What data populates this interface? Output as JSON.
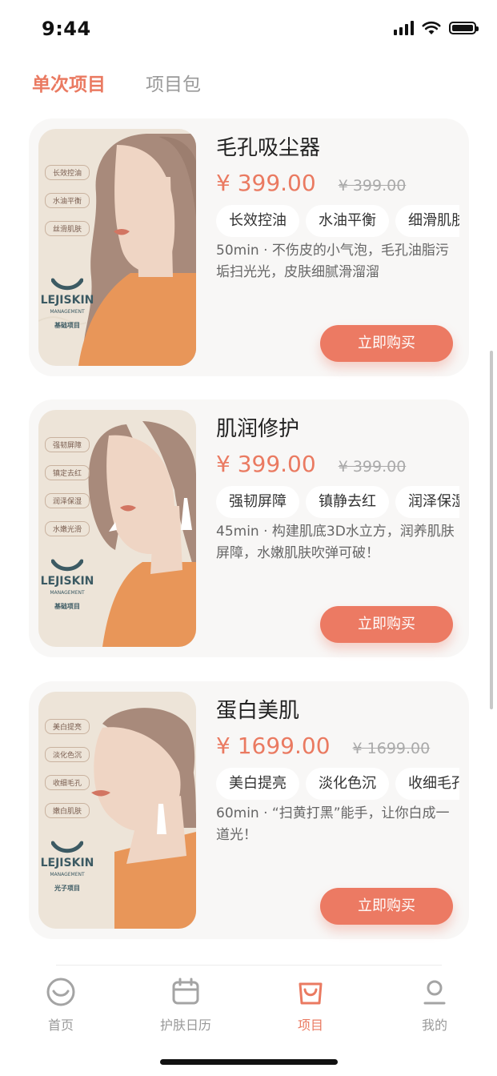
{
  "status": {
    "time": "9:44"
  },
  "tabs": [
    {
      "label": "单次项目",
      "active": true
    },
    {
      "label": "项目包",
      "active": false
    }
  ],
  "products": [
    {
      "title": "毛孔吸尘器",
      "price": "¥ 399.00",
      "original_price": "¥ 399.00",
      "tags": [
        "长效控油",
        "水油平衡",
        "细滑肌肤"
      ],
      "description": "50min · 不伤皮的小气泡，毛孔油脂污垢扫光光，皮肤细腻滑溜溜",
      "button": "立即购买",
      "image": {
        "side_labels": [
          "长效控油",
          "水油平衡",
          "丝滑肌肤"
        ],
        "brand": "LEJISKIN",
        "brand_sub": "MANAGEMENT",
        "category": "基础项目"
      }
    },
    {
      "title": "肌润修护",
      "price": "¥ 399.00",
      "original_price": "¥ 399.00",
      "tags": [
        "强韧屏障",
        "镇静去红",
        "润泽保湿"
      ],
      "description": "45min · 构建肌底3D水立方，润养肌肤屏障，水嫩肌肤吹弹可破！",
      "button": "立即购买",
      "image": {
        "side_labels": [
          "强韧屏障",
          "镇定去红",
          "润泽保湿",
          "水嫩光滑"
        ],
        "brand": "LEJISKIN",
        "brand_sub": "MANAGEMENT",
        "category": "基础项目"
      }
    },
    {
      "title": "蛋白美肌",
      "price": "¥ 1699.00",
      "original_price": "¥ 1699.00",
      "tags": [
        "美白提亮",
        "淡化色沉",
        "收细毛孔"
      ],
      "description": "60min · “扫黄打黑”能手，让你白成一道光！",
      "button": "立即购买",
      "image": {
        "side_labels": [
          "美白提亮",
          "淡化色沉",
          "收细毛孔",
          "嫩白肌肤"
        ],
        "brand": "LEJISKIN",
        "brand_sub": "MANAGEMENT",
        "category": "光子项目"
      }
    }
  ],
  "nav": [
    {
      "label": "首页",
      "icon": "smile-face-icon",
      "active": false
    },
    {
      "label": "护肤日历",
      "icon": "calendar-icon",
      "active": false
    },
    {
      "label": "项目",
      "icon": "shopping-bag-icon",
      "active": true
    },
    {
      "label": "我的",
      "icon": "user-icon",
      "active": false
    }
  ],
  "colors": {
    "accent": "#ea7a61",
    "button": "#ec7a63",
    "card_bg": "#f8f7f6",
    "poster_bg": "#ede4d8"
  }
}
